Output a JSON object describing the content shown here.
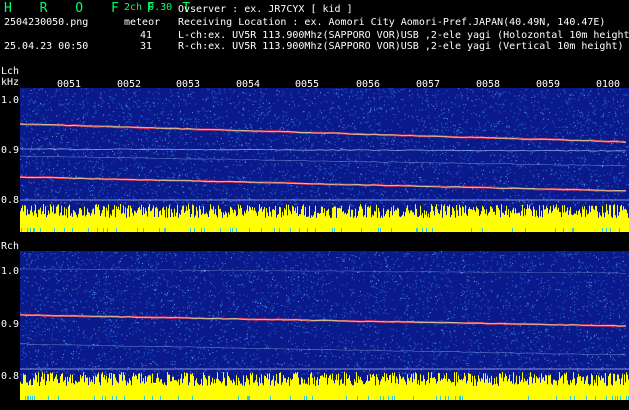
{
  "app": {
    "brand": "H R O F F T",
    "mode": "2ch 0.30",
    "filename": "2504230050.png",
    "datetime": "25.04.23 00:50",
    "meteor_label": "meteor",
    "meteor_counts": [
      "41",
      "31"
    ]
  },
  "info": {
    "observer": "Ovserver           : ex. JR7CYX [ kid ]",
    "location": "Receiving Location : ex. Aomori City Aomori-Pref.JAPAN(40.49N, 140.47E)",
    "lch": "L-ch:ex. UV5R 113.900Mhz(SAPPORO VOR)USB ,2-ele yagi (Holozontal 10m height)",
    "rch": "R-ch:ex. UV5R 113.900Mhz(SAPPORO VOR)USB ,2-ele yagi (Vertical 10m height)"
  },
  "lch": {
    "label": "Lch",
    "unit": "kHz",
    "ticks": [
      "1.0",
      "0.9",
      "0.8"
    ]
  },
  "rch": {
    "label": "Rch",
    "ticks": [
      "1.0",
      "0.9",
      "0.8"
    ]
  },
  "time_ticks": [
    "0051",
    "0052",
    "0053",
    "0054",
    "0055",
    "0056",
    "0057",
    "0058",
    "0059",
    "0100"
  ],
  "colors": {
    "background": "#000000",
    "spectrum_bg": "#0a1a8a",
    "noise": "#1e5cd8",
    "trace": "#ff3b3b",
    "level": "#ffff00",
    "brand": "#00ff66"
  }
}
